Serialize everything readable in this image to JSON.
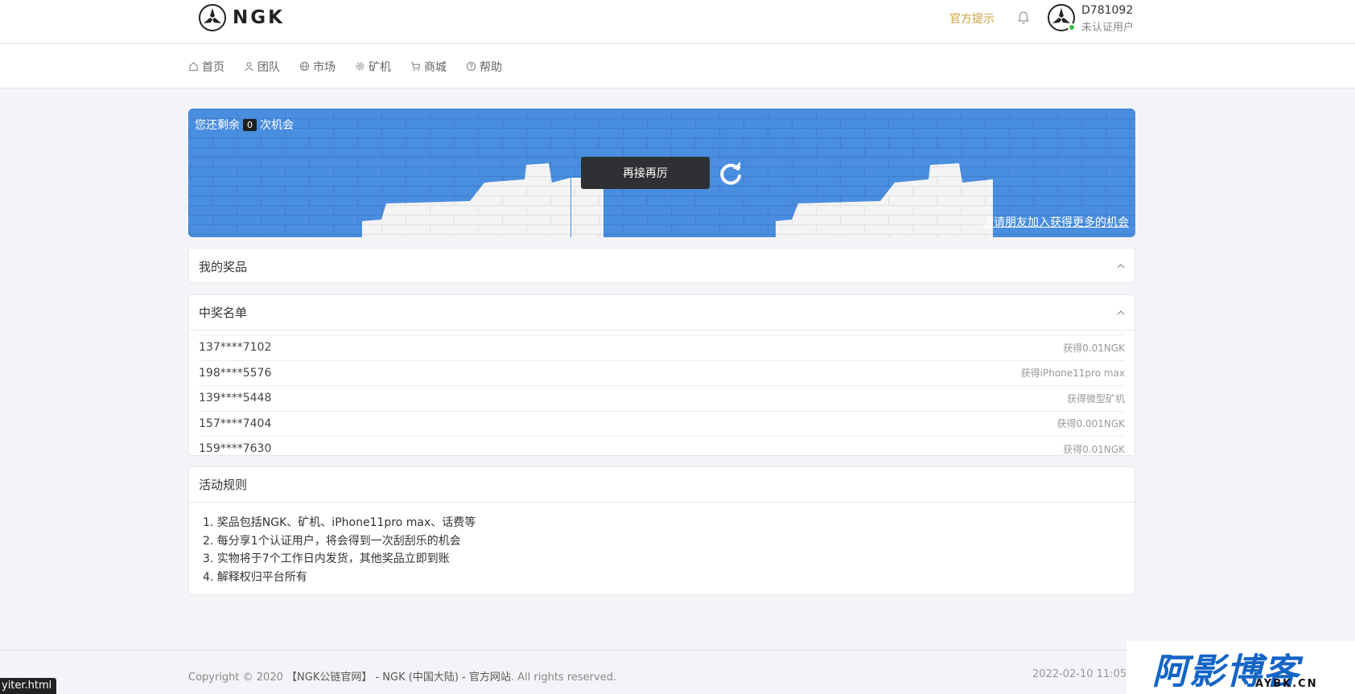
{
  "header": {
    "logo_text": "NGK",
    "notice": "官方提示",
    "user_id": "D781092",
    "user_status": "未认证用户"
  },
  "nav": {
    "items": [
      {
        "label": "首页",
        "icon": "home-icon"
      },
      {
        "label": "团队",
        "icon": "user-icon"
      },
      {
        "label": "市场",
        "icon": "globe-icon"
      },
      {
        "label": "矿机",
        "icon": "gear-icon"
      },
      {
        "label": "商城",
        "icon": "cart-icon"
      },
      {
        "label": "帮助",
        "icon": "help-icon"
      }
    ]
  },
  "scratch": {
    "remain_prefix": "您还剩余",
    "remain_count": "0",
    "remain_suffix": "次机会",
    "retry_label": "再接再厉",
    "invite_text": "邀请朋友加入获得更多的机会",
    "colors": {
      "blue": "#4a8ee0",
      "white": "#f4f4f4"
    }
  },
  "prizes": {
    "title": "我的奖品"
  },
  "winners": {
    "title": "中奖名单",
    "rows": [
      {
        "phone": "137****7102",
        "prize": "获得0.01NGK"
      },
      {
        "phone": "198****5576",
        "prize": "获得iPhone11pro max"
      },
      {
        "phone": "139****5448",
        "prize": "获得微型矿机"
      },
      {
        "phone": "157****7404",
        "prize": "获得0.001NGK"
      },
      {
        "phone": "159****7630",
        "prize": "获得0.01NGK"
      }
    ]
  },
  "rules": {
    "title": "活动规则",
    "items": [
      "1. 奖品包括NGK、矿机、iPhone11pro max、话费等",
      "2. 每分享1个认证用户，将会得到一次刮刮乐的机会",
      "3. 实物将于7个工作日内发货，其他奖品立即到账",
      "4. 解释权归平台所有"
    ]
  },
  "footer": {
    "copyright_prefix": "Copyright © 2020",
    "copyright_site": "【NGK公链官网】 - NGK (中国大陆) - 官方网站",
    "copyright_suffix": ". All rights reserved.",
    "datetime": "2022-02-10 11:05"
  },
  "watermark": {
    "text": "阿影博客",
    "sub": "AYBK.CN"
  },
  "status_bar": {
    "url": "yiter.html"
  }
}
